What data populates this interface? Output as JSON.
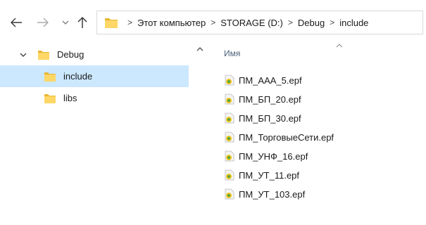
{
  "window": {
    "address": {
      "breadcrumbs": [
        "Этот компьютер",
        "STORAGE (D:)",
        "Debug",
        "include"
      ],
      "separator": ">"
    },
    "navigation": {
      "back_icon": "arrow-left-icon",
      "forward_icon": "arrow-right-icon",
      "recent_icon": "chevron-down-icon",
      "up_icon": "arrow-up-icon"
    },
    "nav_pane": {
      "items": [
        {
          "label": "Debug",
          "expanded": true,
          "icon": "folder-icon"
        },
        {
          "label": "include",
          "selected": true,
          "icon": "folder-icon"
        },
        {
          "label": "libs",
          "icon": "folder-icon"
        }
      ]
    },
    "content": {
      "column_header": "Имя",
      "sort": "ascending",
      "files": [
        {
          "name": "ПМ_ААА_5.epf",
          "icon": "epf-file-icon"
        },
        {
          "name": "ПМ_БП_20.epf",
          "icon": "epf-file-icon"
        },
        {
          "name": "ПМ_БП_30.epf",
          "icon": "epf-file-icon"
        },
        {
          "name": "ПМ_ТорговыеСети.epf",
          "icon": "epf-file-icon"
        },
        {
          "name": "ПМ_УНФ_16.epf",
          "icon": "epf-file-icon"
        },
        {
          "name": "ПМ_УТ_11.epf",
          "icon": "epf-file-icon"
        },
        {
          "name": "ПМ_УТ_103.epf",
          "icon": "epf-file-icon"
        }
      ]
    }
  },
  "colors": {
    "selection": "#cce8ff",
    "folder": "#ffd766",
    "folder_dark": "#e8b630",
    "header_text": "#4c607a",
    "border": "#d9d9d9"
  }
}
